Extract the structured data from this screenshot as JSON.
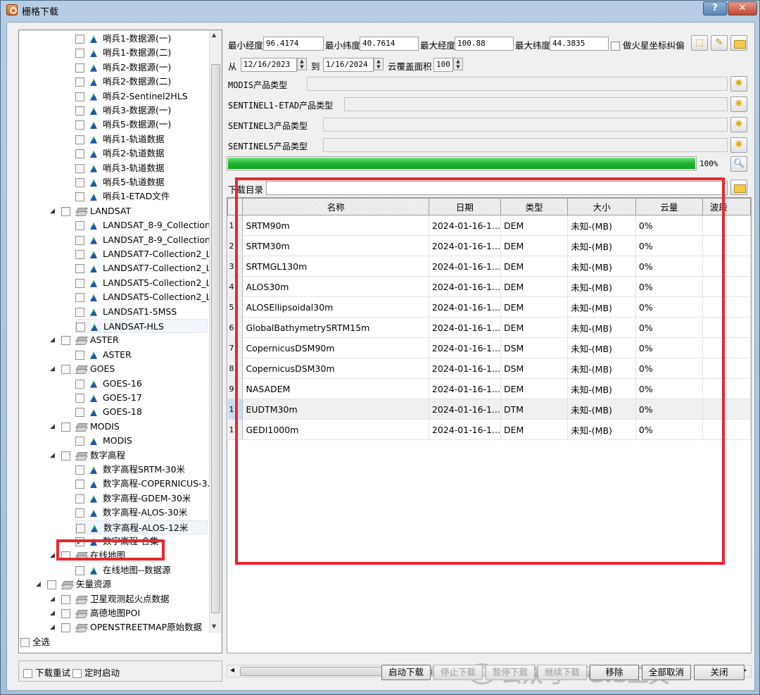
{
  "window": {
    "title": "栅格下载",
    "help": "?",
    "close": "✕"
  },
  "tree": {
    "items": [
      {
        "label": "哨兵1-数据源(一)",
        "level": 2,
        "type": "leaf",
        "checked": false
      },
      {
        "label": "哨兵1-数据源(二)",
        "level": 2,
        "type": "leaf",
        "checked": false
      },
      {
        "label": "哨兵2-数据源(一)",
        "level": 2,
        "type": "leaf",
        "checked": false
      },
      {
        "label": "哨兵2-数据源(二)",
        "level": 2,
        "type": "leaf",
        "checked": false
      },
      {
        "label": "哨兵2-Sentinel2HLS",
        "level": 2,
        "type": "leaf",
        "checked": false
      },
      {
        "label": "哨兵3-数据源(一)",
        "level": 2,
        "type": "leaf",
        "checked": false
      },
      {
        "label": "哨兵5-数据源(一)",
        "level": 2,
        "type": "leaf",
        "checked": false
      },
      {
        "label": "哨兵1-轨道数据",
        "level": 2,
        "type": "leaf",
        "checked": false
      },
      {
        "label": "哨兵2-轨道数据",
        "level": 2,
        "type": "leaf",
        "checked": false
      },
      {
        "label": "哨兵3-轨道数据",
        "level": 2,
        "type": "leaf",
        "checked": false
      },
      {
        "label": "哨兵5-轨道数据",
        "level": 2,
        "type": "leaf",
        "checked": false
      },
      {
        "label": "哨兵1-ETAD文件",
        "level": 2,
        "type": "leaf",
        "checked": false
      },
      {
        "label": "LANDSAT",
        "level": 1,
        "type": "group",
        "checked": false
      },
      {
        "label": "LANDSAT_8-9_Collection...",
        "level": 2,
        "type": "leaf",
        "checked": false
      },
      {
        "label": "LANDSAT_8-9_Collection...",
        "level": 2,
        "type": "leaf",
        "checked": false
      },
      {
        "label": "LANDSAT7-Collection2_L...",
        "level": 2,
        "type": "leaf",
        "checked": false
      },
      {
        "label": "LANDSAT7-Collection2_L...",
        "level": 2,
        "type": "leaf",
        "checked": false
      },
      {
        "label": "LANDSAT5-Collection2_L...",
        "level": 2,
        "type": "leaf",
        "checked": false
      },
      {
        "label": "LANDSAT5-Collection2_L...",
        "level": 2,
        "type": "leaf",
        "checked": false
      },
      {
        "label": "LANDSAT1-5MSS",
        "level": 2,
        "type": "leaf",
        "checked": false
      },
      {
        "label": "LANDSAT-HLS",
        "level": 2,
        "type": "leaf",
        "checked": false,
        "selected": true
      },
      {
        "label": "ASTER",
        "level": 1,
        "type": "group",
        "checked": false
      },
      {
        "label": "ASTER",
        "level": 2,
        "type": "leaf",
        "checked": false
      },
      {
        "label": "GOES",
        "level": 1,
        "type": "group",
        "checked": false
      },
      {
        "label": "GOES-16",
        "level": 2,
        "type": "leaf",
        "checked": false
      },
      {
        "label": "GOES-17",
        "level": 2,
        "type": "leaf",
        "checked": false
      },
      {
        "label": "GOES-18",
        "level": 2,
        "type": "leaf",
        "checked": false
      },
      {
        "label": "MODIS",
        "level": 1,
        "type": "group",
        "checked": false
      },
      {
        "label": "MODIS",
        "level": 2,
        "type": "leaf",
        "checked": false
      },
      {
        "label": "数字高程",
        "level": 1,
        "type": "group",
        "checked": false
      },
      {
        "label": "数字高程SRTM-30米",
        "level": 2,
        "type": "leaf",
        "checked": false
      },
      {
        "label": "数字高程-COPERNICUS-3...",
        "level": 2,
        "type": "leaf",
        "checked": false
      },
      {
        "label": "数字高程-GDEM-30米",
        "level": 2,
        "type": "leaf",
        "checked": false
      },
      {
        "label": "数字高程-ALOS-30米",
        "level": 2,
        "type": "leaf",
        "checked": false
      },
      {
        "label": "数字高程-ALOS-12米",
        "level": 2,
        "type": "leaf",
        "checked": false,
        "selected": true
      },
      {
        "label": "数字高程-合集",
        "level": 2,
        "type": "leaf",
        "checked": true
      },
      {
        "label": "在线地图",
        "level": 1,
        "type": "group",
        "checked": false
      },
      {
        "label": "在线地图--数据源",
        "level": 2,
        "type": "leaf",
        "checked": false
      },
      {
        "label": "矢量资源",
        "level": 0,
        "type": "group",
        "checked": false
      },
      {
        "label": "卫星观测起火点数据",
        "level": 1,
        "type": "group",
        "checked": false
      },
      {
        "label": "高德地图POI",
        "level": 1,
        "type": "group",
        "checked": false
      },
      {
        "label": "OPENSTREETMAP原始数据",
        "level": 1,
        "type": "group",
        "checked": false
      }
    ],
    "select_all": "全选"
  },
  "bbox": {
    "min_lon_label": "最小经度",
    "min_lon": "96.4174",
    "min_lat_label": "最小纬度",
    "min_lat": "40.7614",
    "max_lon_label": "最大经度",
    "max_lon": "100.88",
    "max_lat_label": "最大纬度",
    "max_lat": "44.3835",
    "mars_label": "做火星坐标纠偏"
  },
  "date": {
    "from_label": "从",
    "from": "12/16/2023",
    "to_label": "到",
    "to": "1/16/2024",
    "cloud_label": "云覆盖面积",
    "cloud": "100"
  },
  "products": [
    {
      "label": "MODIS产品类型"
    },
    {
      "label": "SENTINEL1-ETAD产品类型"
    },
    {
      "label": "SENTINEL3产品类型"
    },
    {
      "label": "SENTINEL5产品类型"
    }
  ],
  "progress": {
    "value": 1.0,
    "text": "100%"
  },
  "download_dir": {
    "label": "下载目录",
    "value": ""
  },
  "grid": {
    "columns": [
      "名称",
      "日期",
      "类型",
      "大小",
      "云量",
      "波段"
    ],
    "rows": [
      {
        "num": "1",
        "name": "SRTM90m",
        "date": "2024-01-16-1...",
        "type": "DEM",
        "size": "未知-(MB)",
        "cloud": "0%"
      },
      {
        "num": "2",
        "name": "SRTM30m",
        "date": "2024-01-16-1...",
        "type": "DEM",
        "size": "未知-(MB)",
        "cloud": "0%"
      },
      {
        "num": "3",
        "name": "SRTMGL130m",
        "date": "2024-01-16-1...",
        "type": "DEM",
        "size": "未知-(MB)",
        "cloud": "0%"
      },
      {
        "num": "4",
        "name": "ALOS30m",
        "date": "2024-01-16-1...",
        "type": "DEM",
        "size": "未知-(MB)",
        "cloud": "0%"
      },
      {
        "num": "5",
        "name": "ALOSEllipsoidal30m",
        "date": "2024-01-16-1...",
        "type": "DEM",
        "size": "未知-(MB)",
        "cloud": "0%"
      },
      {
        "num": "6",
        "name": "GlobalBathymetrySRTM15m",
        "date": "2024-01-16-1...",
        "type": "DEM",
        "size": "未知-(MB)",
        "cloud": "0%"
      },
      {
        "num": "7",
        "name": "CopernicusDSM90m",
        "date": "2024-01-16-1...",
        "type": "DSM",
        "size": "未知-(MB)",
        "cloud": "0%"
      },
      {
        "num": "8",
        "name": "CopernicusDSM30m",
        "date": "2024-01-16-1...",
        "type": "DSM",
        "size": "未知-(MB)",
        "cloud": "0%"
      },
      {
        "num": "9",
        "name": "NASADEM",
        "date": "2024-01-16-1...",
        "type": "DEM",
        "size": "未知-(MB)",
        "cloud": "0%"
      },
      {
        "num": "1",
        "name": "EUDTM30m",
        "date": "2024-01-16-1...",
        "type": "DTM",
        "size": "未知-(MB)",
        "cloud": "0%",
        "current": true
      },
      {
        "num": "1",
        "name": "GEDI1000m",
        "date": "2024-01-16-1...",
        "type": "DEM",
        "size": "未知-(MB)",
        "cloud": "0%"
      }
    ]
  },
  "bottom": {
    "retry_label": "下载重试",
    "timer_label": "定时启动",
    "buttons": {
      "start": "启动下载",
      "stop": "停止下载",
      "pause": "暂停下载",
      "resume": "继续下载",
      "remove": "移除",
      "cancel_all": "全部取消",
      "close": "关闭"
    }
  },
  "watermark": "公众号 · GIS工具",
  "colors": {
    "annotation": "#e8282e",
    "progress": "#1fb52f"
  }
}
